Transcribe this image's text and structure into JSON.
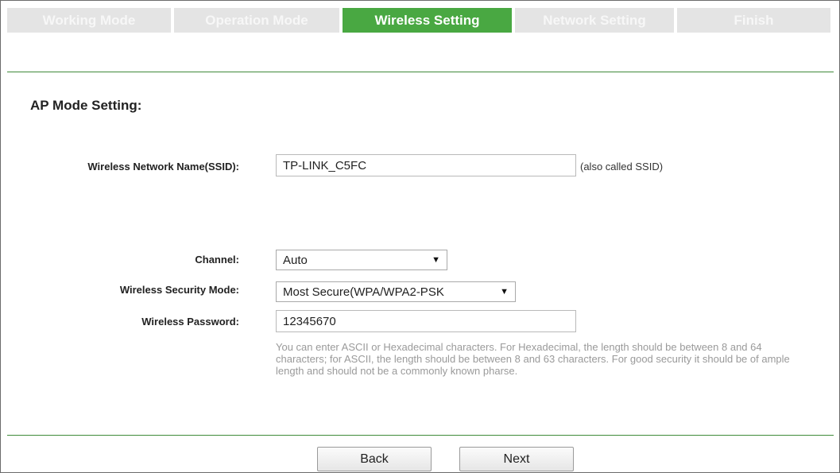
{
  "steps": [
    {
      "label": "Working Mode",
      "active": false
    },
    {
      "label": "Operation Mode",
      "active": false
    },
    {
      "label": "Wireless Setting",
      "active": true
    },
    {
      "label": "Network Setting",
      "active": false
    },
    {
      "label": "Finish",
      "active": false
    }
  ],
  "section": {
    "title": "AP Mode Setting:"
  },
  "form": {
    "ssid_label": "Wireless Network Name(SSID):",
    "ssid_value": "TP-LINK_C5FC",
    "ssid_hint": "(also called SSID)",
    "channel_label": "Channel:",
    "channel_value": "Auto",
    "security_label": "Wireless Security Mode:",
    "security_value": "Most Secure(WPA/WPA2-PSK",
    "password_label": "Wireless Password:",
    "password_value": "12345670",
    "password_help": "You can enter ASCII or Hexadecimal characters. For Hexadecimal, the length should be between 8 and 64 characters; for ASCII, the length should be between 8 and 63 characters. For good security it should be of ample length and should not be a commonly known pharse."
  },
  "buttons": {
    "back": "Back",
    "next": "Next"
  },
  "colors": {
    "active_tab": "#49a842",
    "inactive_tab": "#e4e4e4",
    "rule": "#3f8a3a"
  }
}
